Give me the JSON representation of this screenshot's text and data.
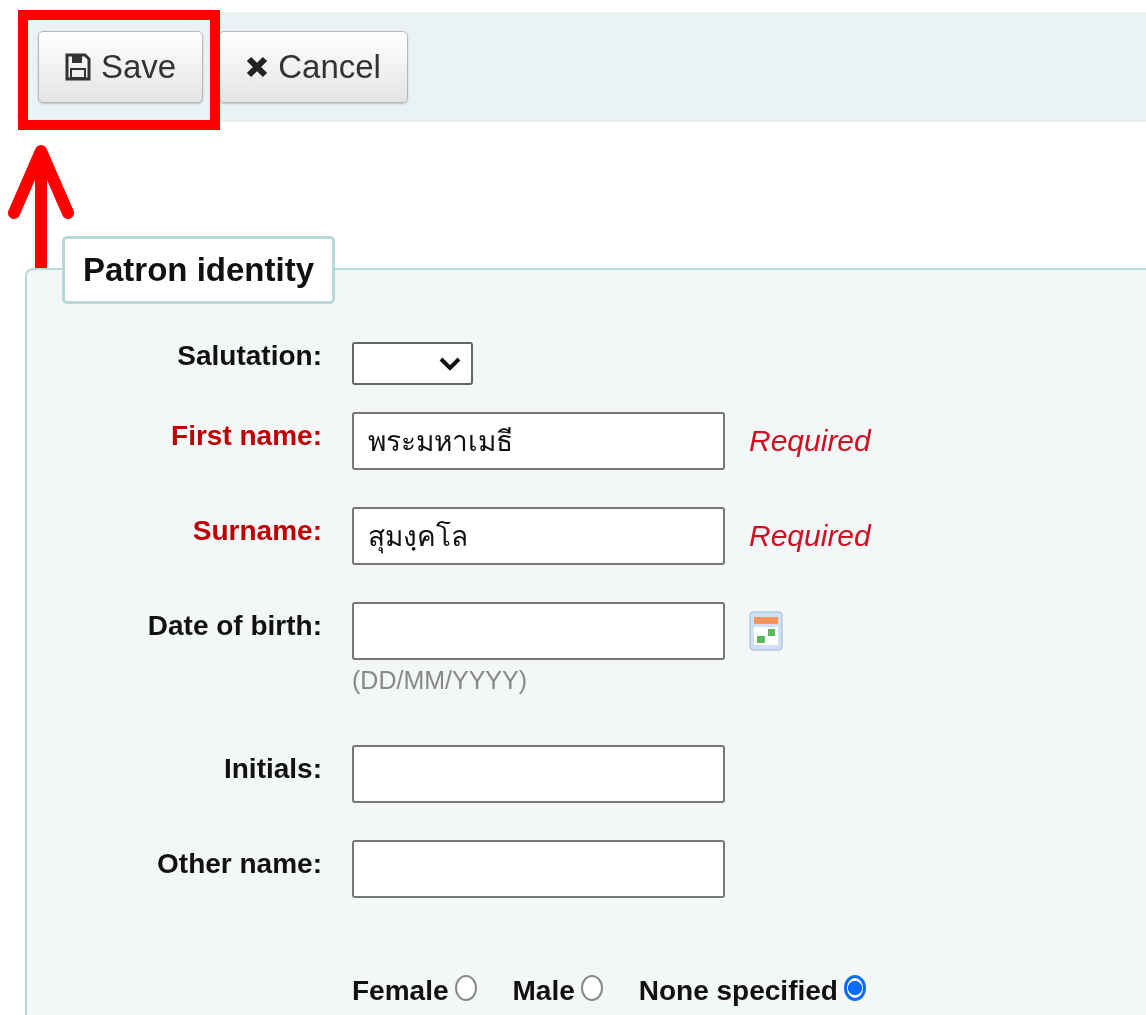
{
  "toolbar": {
    "buttons": [
      {
        "kind": "save",
        "label": "Save"
      },
      {
        "kind": "cancel",
        "label": "Cancel"
      }
    ]
  },
  "fieldset": {
    "legend": "Patron identity",
    "fields": [
      {
        "kind": "select",
        "label": "Salutation:",
        "required": false
      },
      {
        "kind": "text",
        "label": "First name:",
        "value": "พระมหาเมธี",
        "required": true,
        "note": "Required"
      },
      {
        "kind": "text",
        "label": "Surname:",
        "value": "สุมงฺคโล",
        "required": true,
        "note": "Required"
      },
      {
        "kind": "date",
        "label": "Date of birth:",
        "required": false,
        "hint": "(DD/MM/YYYY)"
      },
      {
        "kind": "text",
        "label": "Initials:",
        "required": false
      },
      {
        "kind": "text",
        "label": "Other name:",
        "required": false
      }
    ],
    "gender": [
      {
        "label": "Female",
        "selected": false
      },
      {
        "label": "Male",
        "selected": false
      },
      {
        "label": "None specified",
        "selected": true
      }
    ]
  }
}
